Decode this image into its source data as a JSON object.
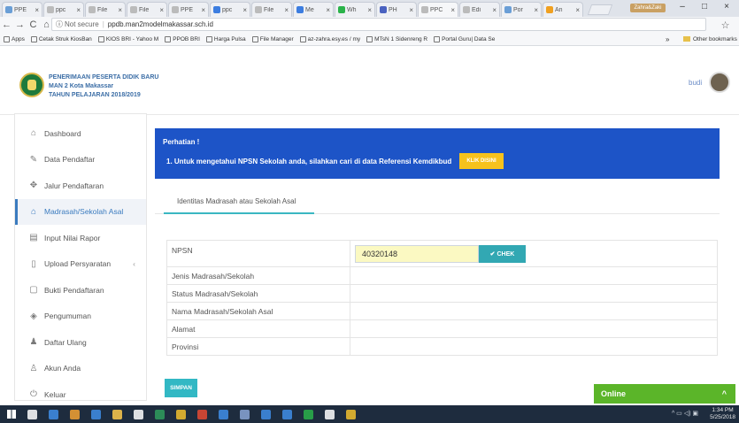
{
  "browser": {
    "tabs": [
      {
        "label": "PPE",
        "color": "#6a9ed6"
      },
      {
        "label": "ppc",
        "color": "#bbbbbb"
      },
      {
        "label": "File",
        "color": "#bbbbbb"
      },
      {
        "label": "File",
        "color": "#bbbbbb"
      },
      {
        "label": "PPE",
        "color": "#bbbbbb"
      },
      {
        "label": "ppc",
        "color": "#3c7de0"
      },
      {
        "label": "File",
        "color": "#bbbbbb"
      },
      {
        "label": "Me",
        "color": "#3c7de0"
      },
      {
        "label": "Wh",
        "color": "#2ab34a"
      },
      {
        "label": "PH",
        "color": "#4a62c0"
      },
      {
        "label": "PPC",
        "color": "#bbbbbb"
      },
      {
        "label": "Edi",
        "color": "#bbbbbb"
      },
      {
        "label": "Por",
        "color": "#6a9ed6"
      },
      {
        "label": "An",
        "color": "#f0a020"
      }
    ],
    "profile_label": "Zahra&Zaki",
    "window_controls": {
      "minimize": "–",
      "maximize": "□",
      "close": "×"
    },
    "address": {
      "security": "Not secure",
      "url": "ppdb.man2modelmakassar.sch.id"
    },
    "bookmarks": [
      "Apps",
      "Cetak Struk KiosBan",
      "KIOS BRI - Yahoo M",
      "PPOB BRI",
      "Harga Pulsa",
      "File Manager",
      "az-zahra.esy.es / my",
      "MTsN 1 Sidenreng R",
      "Portal Guru| Data Se"
    ],
    "bookmarks_overflow": "»",
    "other_bookmarks": "Other bookmarks"
  },
  "header": {
    "line1": "PENERIMAAN PESERTA DIDIK BARU",
    "line2": "MAN 2 Kota Makassar",
    "line3": "TAHUN PELAJARAN 2018/2019",
    "username": "budi"
  },
  "sidebar": {
    "items": [
      {
        "label": "Dashboard",
        "icon": "home-icon",
        "glyph": "⌂",
        "active": false
      },
      {
        "label": "Data Pendaftar",
        "icon": "edit-icon",
        "glyph": "✎",
        "active": false
      },
      {
        "label": "Jalur Pendaftaran",
        "icon": "arrows-icon",
        "glyph": "✥",
        "active": false
      },
      {
        "label": "Madrasah/Sekolah Asal",
        "icon": "school-icon",
        "glyph": "⌂",
        "active": true
      },
      {
        "label": "Input Nilai Rapor",
        "icon": "book-icon",
        "glyph": "▤",
        "active": false
      },
      {
        "label": "Upload Persyaratan",
        "icon": "file-icon",
        "glyph": "▯",
        "active": false
      },
      {
        "label": "Bukti Pendaftaran",
        "icon": "receipt-icon",
        "glyph": "▢",
        "active": false
      },
      {
        "label": "Pengumuman",
        "icon": "layers-icon",
        "glyph": "◈",
        "active": false
      },
      {
        "label": "Daftar Ulang",
        "icon": "users-icon",
        "glyph": "♟",
        "active": false
      },
      {
        "label": "Akun Anda",
        "icon": "user-icon",
        "glyph": "♙",
        "active": false
      },
      {
        "label": "Keluar",
        "icon": "power-icon",
        "glyph": "⏻",
        "active": false
      }
    ],
    "upload_chevron": "‹"
  },
  "notice": {
    "title": "Perhatian !",
    "message": "1. Untuk mengetahui NPSN Sekolah anda, silahkan cari di data Referensi Kemdikbud",
    "button": "KLIK DISINI"
  },
  "tab": {
    "label": "Identitas Madrasah atau Sekolah Asal"
  },
  "form": {
    "npsn_label": "NPSN",
    "npsn_value": "40320148",
    "check_button": "✔ CHEK",
    "rows": [
      {
        "label": "Jenis Madrasah/Sekolah",
        "value": ""
      },
      {
        "label": "Status Madrasah/Sekolah",
        "value": ""
      },
      {
        "label": "Nama Madrasah/Sekolah Asal",
        "value": ""
      },
      {
        "label": "Alamat",
        "value": ""
      },
      {
        "label": "Provinsi",
        "value": ""
      }
    ],
    "save_button": "SIMPAN"
  },
  "chat": {
    "label": "Online",
    "toggle": "^"
  },
  "taskbar": {
    "apps": [
      "#ffffff",
      "#3f8ee8",
      "#f4a233",
      "#3f8ee8",
      "#ffcb4c",
      "#ffffff",
      "#2f9e5d",
      "#f2c12e",
      "#e64a33",
      "#3f8ee8",
      "#8aa6d6",
      "#3f8ee8",
      "#3f8ee8",
      "#2ab34a",
      "#ffffff",
      "#f2c12e"
    ],
    "time": "1:34 PM",
    "date": "5/25/2018"
  }
}
